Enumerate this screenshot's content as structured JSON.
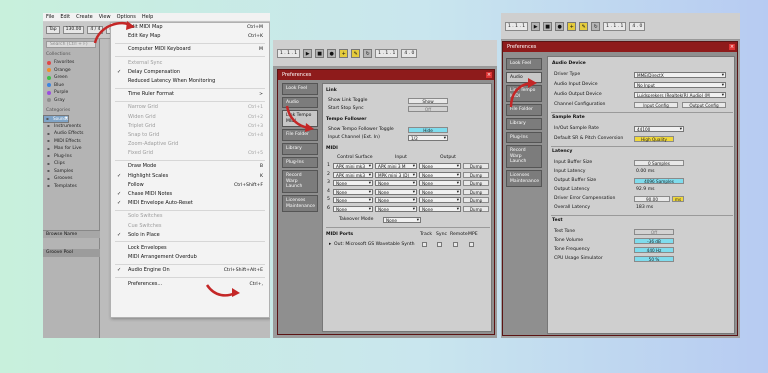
{
  "colors": {
    "accent_red": "#c42727",
    "title_bar": "#8e1b1b",
    "cyan_field": "#7fdced",
    "yellow_field": "#f0d83c",
    "selected": "#7fa4c7"
  },
  "panel1": {
    "menubar": [
      "File",
      "Edit",
      "Create",
      "View",
      "Options",
      "Help"
    ],
    "toolbar": {
      "tap": "Tap",
      "bpm": "130.00",
      "meter": "4 / 4",
      "play": "● ●",
      "bar": "1 Bar"
    },
    "search_placeholder": "Search (Ctrl + F)",
    "collections_header": "Collections",
    "collections": [
      {
        "label": "Favorites",
        "color": "#e04848"
      },
      {
        "label": "Orange",
        "color": "#f0902a"
      },
      {
        "label": "Green",
        "color": "#3cc14a"
      },
      {
        "label": "Blue",
        "color": "#3c86e0"
      },
      {
        "label": "Purple",
        "color": "#9a4ee0"
      },
      {
        "label": "Gray",
        "color": "#8e8e8e"
      }
    ],
    "categories_header": "Categories",
    "categories": [
      {
        "label": "Sounds",
        "icon": "sound-icon"
      },
      {
        "label": "Drums",
        "icon": "drums-icon"
      },
      {
        "label": "Instruments",
        "icon": "instrument-icon"
      },
      {
        "label": "Audio Effects",
        "icon": "effect-icon"
      },
      {
        "label": "MIDI Effects",
        "icon": "effect-icon"
      },
      {
        "label": "Max for Live",
        "icon": "max-icon"
      },
      {
        "label": "Plug-Ins",
        "icon": "plugin-icon"
      },
      {
        "label": "Clips",
        "icon": "clip-icon"
      },
      {
        "label": "Samples",
        "icon": "sample-icon"
      },
      {
        "label": "Grooves",
        "icon": "groove-icon"
      },
      {
        "label": "Templates",
        "icon": "template-icon"
      }
    ],
    "browse_name": "Browse Name",
    "groove_pool": "Groove Pool",
    "menu": [
      {
        "label": "Edit MIDI Map",
        "shortcut": "Ctrl+M",
        "disabled": false,
        "checked": false
      },
      {
        "label": "Edit Key Map",
        "shortcut": "Ctrl+K",
        "disabled": false,
        "checked": false
      },
      {
        "sep": true
      },
      {
        "label": "Computer MIDI Keyboard",
        "shortcut": "M",
        "disabled": false,
        "checked": false
      },
      {
        "sep": true
      },
      {
        "label": "External Sync",
        "shortcut": "",
        "disabled": true,
        "checked": false
      },
      {
        "label": "Delay Compensation",
        "shortcut": "",
        "disabled": false,
        "checked": true
      },
      {
        "label": "Reduced Latency When Monitoring",
        "shortcut": "",
        "disabled": false,
        "checked": false
      },
      {
        "sep": true
      },
      {
        "label": "Time Ruler Format",
        "shortcut": ">",
        "disabled": false,
        "checked": false
      },
      {
        "sep": true
      },
      {
        "label": "Narrow Grid",
        "shortcut": "Ctrl+1",
        "disabled": true,
        "checked": false
      },
      {
        "label": "Widen Grid",
        "shortcut": "Ctrl+2",
        "disabled": true,
        "checked": false
      },
      {
        "label": "Triplet Grid",
        "shortcut": "Ctrl+3",
        "disabled": true,
        "checked": false
      },
      {
        "label": "Snap to Grid",
        "shortcut": "Ctrl+4",
        "disabled": true,
        "checked": false
      },
      {
        "label": "Zoom-Adaptive Grid",
        "shortcut": "",
        "disabled": true,
        "checked": false
      },
      {
        "label": "Fixed Grid",
        "shortcut": "Ctrl+5",
        "disabled": true,
        "checked": false
      },
      {
        "sep": true
      },
      {
        "label": "Draw Mode",
        "shortcut": "B",
        "disabled": false,
        "checked": false
      },
      {
        "label": "Highlight Scales",
        "shortcut": "K",
        "disabled": false,
        "checked": true
      },
      {
        "label": "Follow",
        "shortcut": "Ctrl+Shift+F",
        "disabled": false,
        "checked": false
      },
      {
        "label": "Chase MIDI Notes",
        "shortcut": "",
        "disabled": false,
        "checked": true
      },
      {
        "label": "MIDI Envelope Auto-Reset",
        "shortcut": "",
        "disabled": false,
        "checked": true
      },
      {
        "sep": true
      },
      {
        "label": "Solo Switches",
        "shortcut": "",
        "disabled": true,
        "checked": false
      },
      {
        "label": "Cue Switches",
        "shortcut": "",
        "disabled": true,
        "checked": false
      },
      {
        "label": "Solo in Place",
        "shortcut": "",
        "disabled": false,
        "checked": true
      },
      {
        "sep": true
      },
      {
        "label": "Lock Envelopes",
        "shortcut": "",
        "disabled": false,
        "checked": false
      },
      {
        "label": "MIDI Arrangement Overdub",
        "shortcut": "",
        "disabled": false,
        "checked": false
      },
      {
        "sep": true
      },
      {
        "label": "Audio Engine On",
        "shortcut": "Ctrl+Shift+Alt+E",
        "disabled": false,
        "checked": true
      },
      {
        "sep": true
      },
      {
        "label": "Preferences...",
        "shortcut": "Ctrl+,",
        "disabled": false,
        "checked": false
      }
    ]
  },
  "panel2": {
    "title": "Preferences",
    "close": "×",
    "tabs": [
      "Look Feel",
      "Audio",
      "Link Tempo MIDI",
      "File Folder",
      "Library",
      "Plug-Ins",
      "Record Warp Launch",
      "Licenses Maintenance"
    ],
    "link_header": "Link",
    "show_link_toggle": {
      "label": "Show Link Toggle",
      "value": "Show"
    },
    "start_stop_sync": {
      "label": "Start Stop Sync",
      "value": "Off"
    },
    "tempo_follower_header": "Tempo Follower",
    "show_tempo_toggle": {
      "label": "Show Tempo Follower Toggle",
      "value": "Hide"
    },
    "input_channel": {
      "label": "Input Channel (Ext. In)",
      "value": "1/2"
    },
    "midi_header": "MIDI",
    "midi_cols": [
      "Control Surface",
      "Input",
      "Output"
    ],
    "midi_rows": [
      {
        "n": "1",
        "surface": "APK mini mk3",
        "input": "APK mini 3 M",
        "output": "None",
        "btn": "Dump"
      },
      {
        "n": "2",
        "surface": "APK mini mk3",
        "input": "MPK mini 3 (D)",
        "output": "None",
        "btn": "Dump"
      },
      {
        "n": "3",
        "surface": "None",
        "input": "None",
        "output": "None",
        "btn": "Dump"
      },
      {
        "n": "4",
        "surface": "None",
        "input": "None",
        "output": "None",
        "btn": "Dump"
      },
      {
        "n": "5",
        "surface": "None",
        "input": "None",
        "output": "None",
        "btn": "Dump"
      },
      {
        "n": "6",
        "surface": "None",
        "input": "None",
        "output": "None",
        "btn": "Dump"
      }
    ],
    "takeover": {
      "label": "Takeover Mode",
      "value": "None"
    },
    "midi_ports_header": "MIDI Ports",
    "port_cols": [
      "Track",
      "Sync",
      "Remote",
      "MPE"
    ],
    "port_row": "Out: Microsoft GS Wavetable Synth"
  },
  "panel3": {
    "title": "Preferences",
    "close": "×",
    "tabs": [
      "Look Feel",
      "Audio",
      "Link Tempo MIDI",
      "File Folder",
      "Library",
      "Plug-Ins",
      "Record Warp Launch",
      "Licenses Maintenance"
    ],
    "audio_device_header": "Audio Device",
    "driver_type": {
      "label": "Driver Type",
      "value": "MME/DirectX"
    },
    "input_device": {
      "label": "Audio Input Device",
      "value": "No Input"
    },
    "output_device": {
      "label": "Audio Output Device",
      "value": "Luidsprekers (Realtek(R) Audio) (M"
    },
    "channel_config": {
      "label": "Channel Configuration",
      "btn1": "Input Config",
      "btn2": "Output Config"
    },
    "sample_rate_header": "Sample Rate",
    "in_out_rate": {
      "label": "In/Out Sample Rate",
      "value": "44100"
    },
    "default_sr": {
      "label": "Default SR & Pitch Conversion",
      "value": "High Quality"
    },
    "latency_header": "Latency",
    "input_buffer": {
      "label": "Input Buffer Size",
      "value": "0 Samples"
    },
    "input_latency": {
      "label": "Input Latency",
      "value": "0.00 ms"
    },
    "output_buffer": {
      "label": "Output Buffer Size",
      "value": "4096 Samples"
    },
    "output_latency": {
      "label": "Output Latency",
      "value": "92.9 ms"
    },
    "driver_error": {
      "label": "Driver Error Compensation",
      "value": "90.00",
      "unit": "ms"
    },
    "overall_latency": {
      "label": "Overall Latency",
      "value": "183 ms"
    },
    "test_header": "Test",
    "test_tone": {
      "label": "Test Tone",
      "value": "Off"
    },
    "tone_volume": {
      "label": "Tone Volume",
      "value": "-36 dB"
    },
    "tone_freq": {
      "label": "Tone Frequency",
      "value": "440 Hz"
    },
    "cpu_sim": {
      "label": "CPU Usage Simulator",
      "value": "50 %"
    }
  }
}
